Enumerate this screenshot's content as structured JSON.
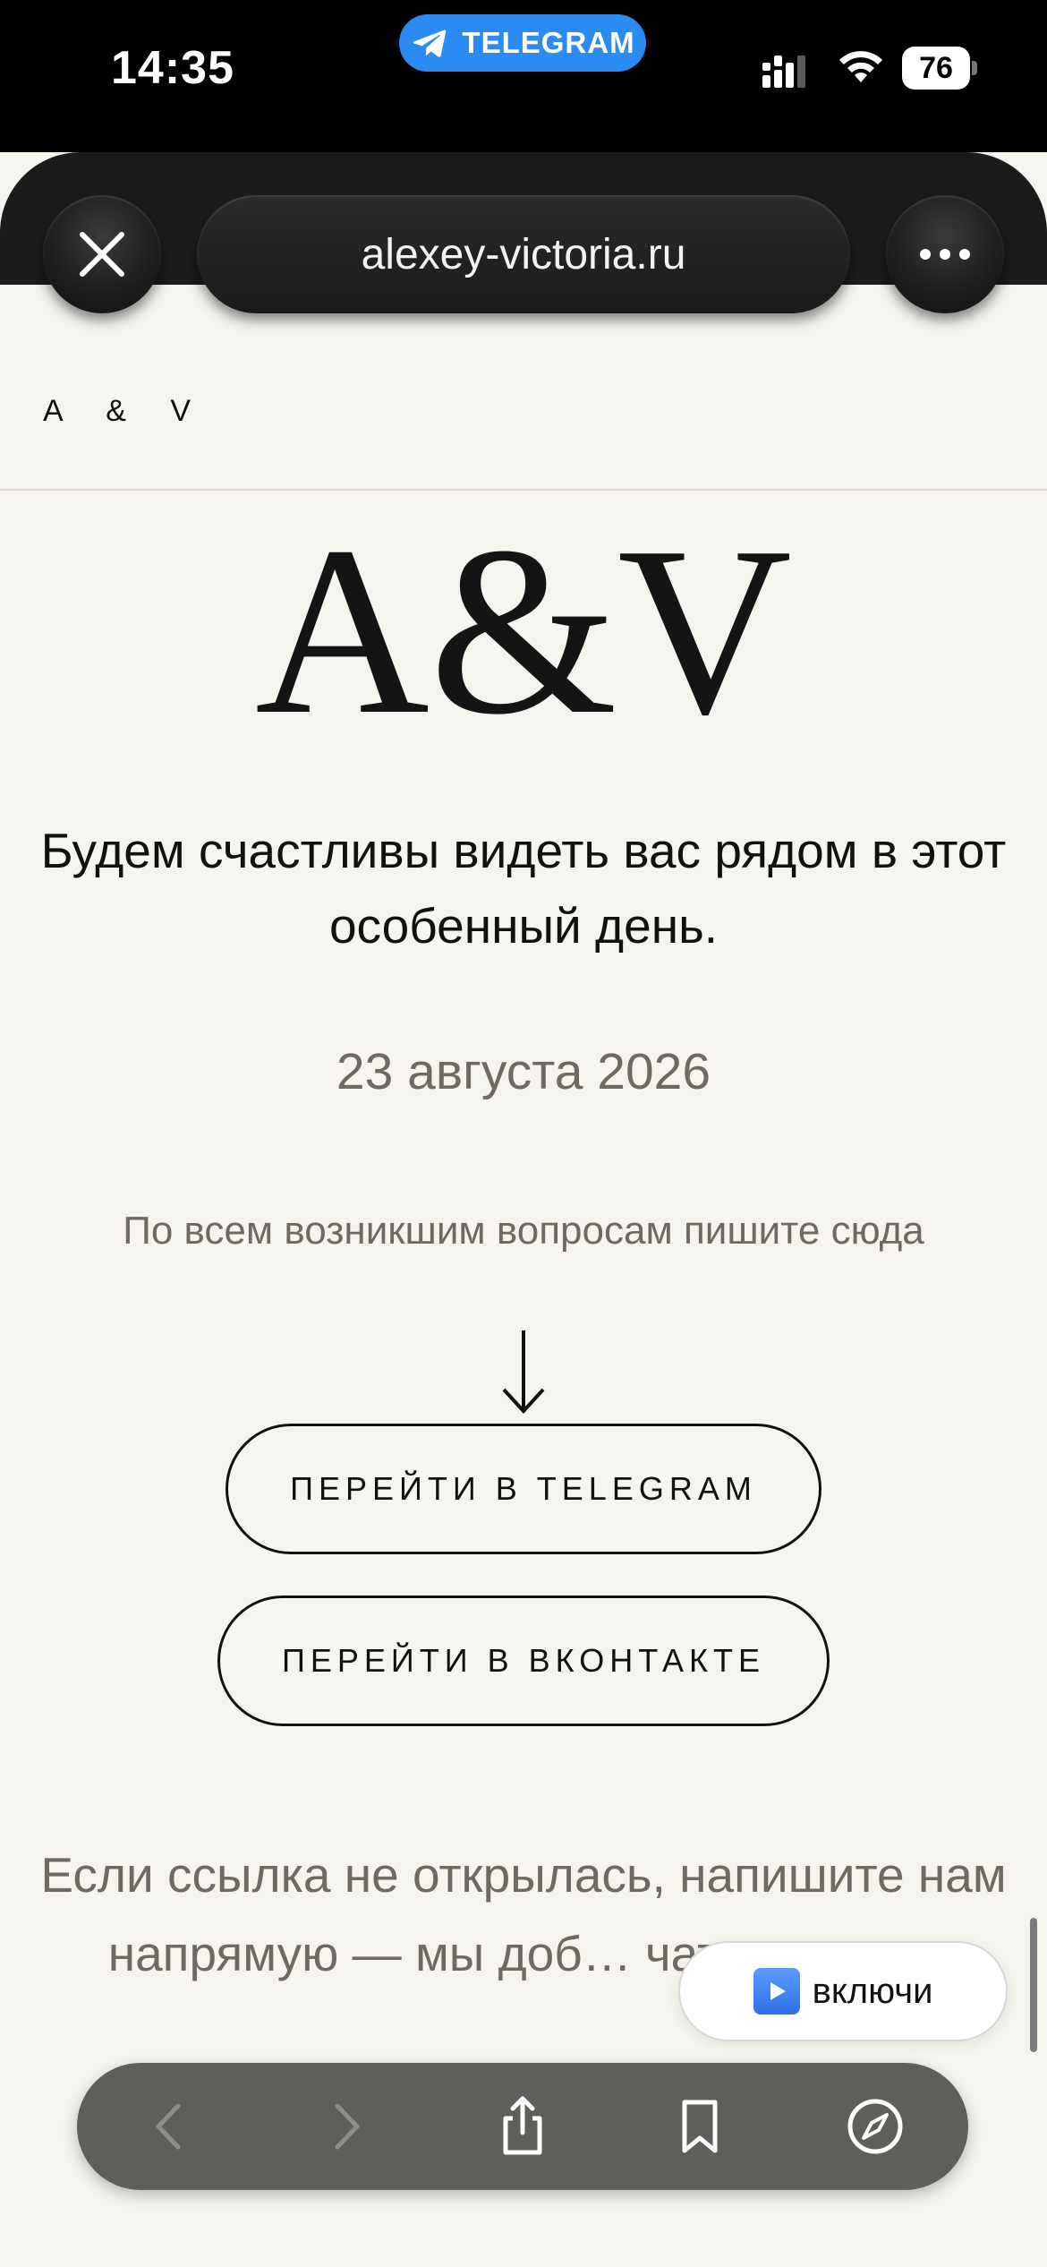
{
  "status_bar": {
    "time": "14:35",
    "app_pill": "TELEGRAM",
    "battery": "76",
    "icons": [
      "telegram-icon",
      "signal-icon",
      "wifi-icon",
      "battery-icon"
    ]
  },
  "browser": {
    "url": "alexey-victoria.ru",
    "close_icon": "close-icon",
    "more_icon": "more-icon"
  },
  "page": {
    "header_logo": "A & V",
    "monogram": "A&V",
    "subtitle": "Будем счастливы видеть вас рядом в этот особенный день.",
    "date": "23 августа 2026",
    "questions": "По всем возникшим вопросам пишите сюда",
    "arrow_icon": "arrow-down-icon",
    "buttons": {
      "telegram": "ПЕРЕЙТИ В TELEGRAM",
      "vk": "ПЕРЕЙТИ В ВКОНТАКТЕ"
    },
    "fallback": "Если ссылка не открылась, напишите нам напрямую — мы доб… чат вручную."
  },
  "music": {
    "label": "включи",
    "icon": "play-icon"
  },
  "toolbar": {
    "items": [
      "back-icon",
      "forward-icon",
      "share-icon",
      "bookmarks-icon",
      "compass-icon"
    ]
  },
  "colors": {
    "page_background": "#f6f4ee",
    "status_bar": "#000000",
    "telegram_blue": "#2a8cf3",
    "muted_text": "#6e6a63",
    "toolbar": "#5f5e5b"
  }
}
